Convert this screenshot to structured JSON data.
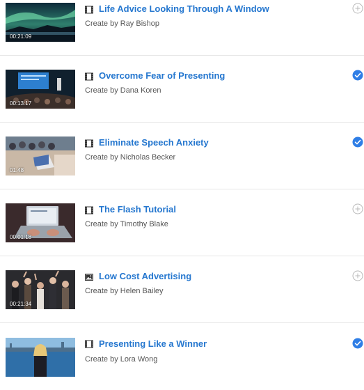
{
  "colors": {
    "title": "#2577cf",
    "check": "#2f7ee6",
    "add": "#b9b9b9",
    "author": "#555555"
  },
  "items": [
    {
      "title": "Life Advice Looking Through A Window",
      "author": "Create by Ray Bishop",
      "duration": "00:21:09",
      "type_icon": "film-icon",
      "status": "add",
      "status_icon": "add-circle-icon"
    },
    {
      "title": "Overcome Fear of Presenting",
      "author": "Create by Dana Koren",
      "duration": "00:13:17",
      "type_icon": "film-icon",
      "status": "completed",
      "status_icon": "check-circle-icon"
    },
    {
      "title": "Eliminate Speech Anxiety",
      "author": "Create by Nicholas Becker",
      "duration": "01:48",
      "type_icon": "film-icon",
      "status": "completed",
      "status_icon": "check-circle-icon"
    },
    {
      "title": "The Flash Tutorial",
      "author": "Create by Timothy Blake",
      "duration": "00:01:18",
      "type_icon": "film-icon",
      "status": "add",
      "status_icon": "add-circle-icon"
    },
    {
      "title": "Low Cost Advertising",
      "author": "Create by Helen Bailey",
      "duration": "00:21:34",
      "type_icon": "image-icon",
      "status": "add",
      "status_icon": "add-circle-icon"
    },
    {
      "title": "Presenting Like a Winner",
      "author": "Create by Lora Wong",
      "duration": "",
      "type_icon": "film-icon",
      "status": "completed",
      "status_icon": "check-circle-icon"
    }
  ]
}
